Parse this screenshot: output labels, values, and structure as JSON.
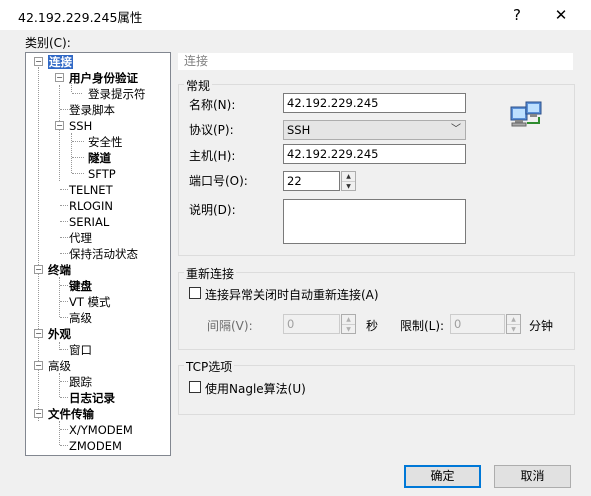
{
  "window": {
    "title": "42.192.229.245属性",
    "help_label": "?",
    "close_label": "✕"
  },
  "category_label": "类别(C):",
  "tree": [
    {
      "label": "连接",
      "bold": true,
      "selected": true
    },
    {
      "label": "用户身份验证",
      "bold": true
    },
    {
      "label": "登录提示符"
    },
    {
      "label": "登录脚本"
    },
    {
      "label": "SSH"
    },
    {
      "label": "安全性"
    },
    {
      "label": "隧道",
      "bold": true
    },
    {
      "label": "SFTP"
    },
    {
      "label": "TELNET"
    },
    {
      "label": "RLOGIN"
    },
    {
      "label": "SERIAL"
    },
    {
      "label": "代理"
    },
    {
      "label": "保持活动状态"
    },
    {
      "label": "终端",
      "bold": true
    },
    {
      "label": "键盘",
      "bold": true
    },
    {
      "label": "VT 模式"
    },
    {
      "label": "高级"
    },
    {
      "label": "外观",
      "bold": true
    },
    {
      "label": "窗口"
    },
    {
      "label": "高级"
    },
    {
      "label": "跟踪"
    },
    {
      "label": "日志记录",
      "bold": true
    },
    {
      "label": "文件传输",
      "bold": true
    },
    {
      "label": "X/YMODEM"
    },
    {
      "label": "ZMODEM"
    }
  ],
  "panel": {
    "header": "连接",
    "general": {
      "title": "常规",
      "name_label": "名称(N):",
      "name_value": "42.192.229.245",
      "protocol_label": "协议(P):",
      "protocol_value": "SSH",
      "host_label": "主机(H):",
      "host_value": "42.192.229.245",
      "port_label": "端口号(O):",
      "port_value": "22",
      "desc_label": "说明(D):",
      "desc_value": ""
    },
    "reconnect": {
      "title": "重新连接",
      "checkbox_label": "连接异常关闭时自动重新连接(A)",
      "checked": false,
      "interval_label": "间隔(V):",
      "interval_value": "0",
      "seconds_label": "秒",
      "limit_label": "限制(L):",
      "limit_value": "0",
      "minutes_label": "分钟"
    },
    "tcp": {
      "title": "TCP选项",
      "checkbox_label": "使用Nagle算法(U)",
      "checked": false
    }
  },
  "buttons": {
    "ok": "确定",
    "cancel": "取消"
  },
  "colors": {
    "selection": "#3169c6",
    "default_button_border": "#0078d7"
  },
  "icons": {
    "computer": "network-computers-icon"
  }
}
